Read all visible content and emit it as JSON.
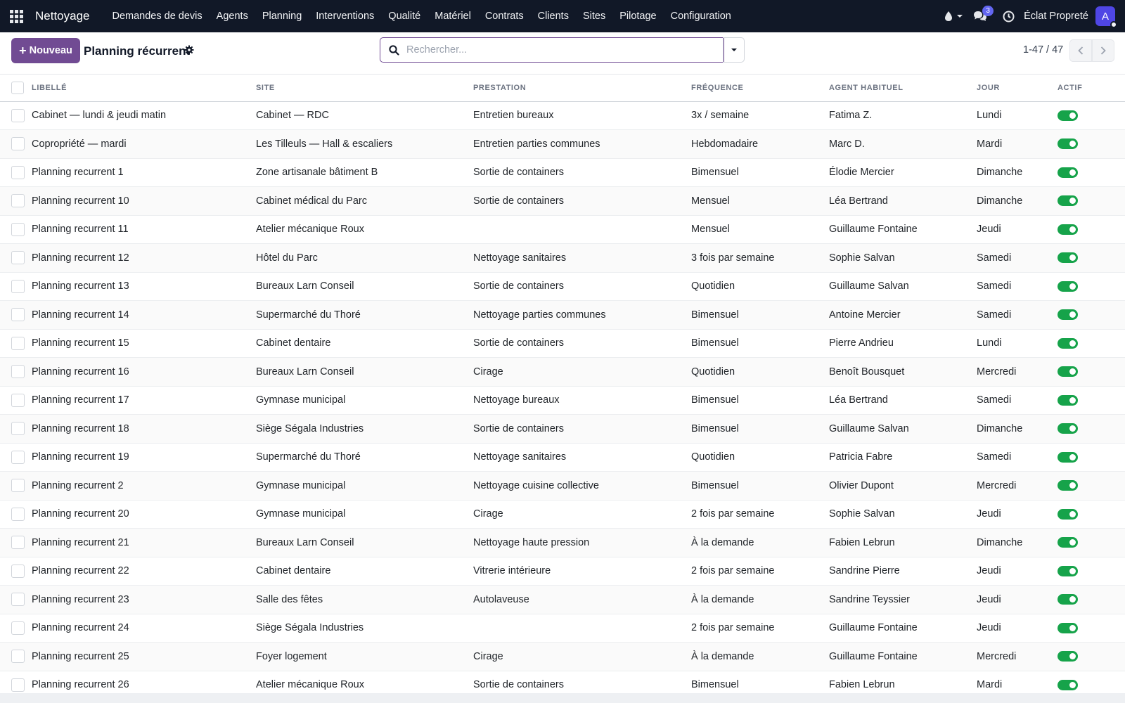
{
  "navbar": {
    "brand": "Nettoyage",
    "menu": [
      "Demandes de devis",
      "Agents",
      "Planning",
      "Interventions",
      "Qualité",
      "Matériel",
      "Contrats",
      "Clients",
      "Sites",
      "Pilotage",
      "Configuration"
    ],
    "messages_count": "3",
    "company": "Éclat Propreté",
    "avatar_letter": "A"
  },
  "control": {
    "new_label": "Nouveau",
    "title": "Planning récurrent",
    "search_placeholder": "Rechercher...",
    "pager": "1-47 / 47"
  },
  "table": {
    "columns": [
      "LIBELLÉ",
      "SITE",
      "PRESTATION",
      "FRÉQUENCE",
      "AGENT HABITUEL",
      "JOUR",
      "ACTIF"
    ],
    "rows": [
      {
        "libelle": "Cabinet — lundi & jeudi matin",
        "site": "Cabinet — RDC",
        "prestation": "Entretien bureaux",
        "frequence": "3x / semaine",
        "agent": "Fatima Z.",
        "jour": "Lundi",
        "actif": true
      },
      {
        "libelle": "Copropriété — mardi",
        "site": "Les Tilleuls — Hall & escaliers",
        "prestation": "Entretien parties communes",
        "frequence": "Hebdomadaire",
        "agent": "Marc D.",
        "jour": "Mardi",
        "actif": true
      },
      {
        "libelle": "Planning recurrent 1",
        "site": "Zone artisanale bâtiment B",
        "prestation": "Sortie de containers",
        "frequence": "Bimensuel",
        "agent": "Élodie Mercier",
        "jour": "Dimanche",
        "actif": true
      },
      {
        "libelle": "Planning recurrent 10",
        "site": "Cabinet médical du Parc",
        "prestation": "Sortie de containers",
        "frequence": "Mensuel",
        "agent": "Léa Bertrand",
        "jour": "Dimanche",
        "actif": true
      },
      {
        "libelle": "Planning recurrent 11",
        "site": "Atelier mécanique Roux",
        "prestation": "",
        "frequence": "Mensuel",
        "agent": "Guillaume Fontaine",
        "jour": "Jeudi",
        "actif": true
      },
      {
        "libelle": "Planning recurrent 12",
        "site": "Hôtel du Parc",
        "prestation": "Nettoyage sanitaires",
        "frequence": "3 fois par semaine",
        "agent": "Sophie Salvan",
        "jour": "Samedi",
        "actif": true
      },
      {
        "libelle": "Planning recurrent 13",
        "site": "Bureaux Larn Conseil",
        "prestation": "Sortie de containers",
        "frequence": "Quotidien",
        "agent": "Guillaume Salvan",
        "jour": "Samedi",
        "actif": true
      },
      {
        "libelle": "Planning recurrent 14",
        "site": "Supermarché du Thoré",
        "prestation": "Nettoyage parties communes",
        "frequence": "Bimensuel",
        "agent": "Antoine Mercier",
        "jour": "Samedi",
        "actif": true
      },
      {
        "libelle": "Planning recurrent 15",
        "site": "Cabinet dentaire",
        "prestation": "Sortie de containers",
        "frequence": "Bimensuel",
        "agent": "Pierre Andrieu",
        "jour": "Lundi",
        "actif": true
      },
      {
        "libelle": "Planning recurrent 16",
        "site": "Bureaux Larn Conseil",
        "prestation": "Cirage",
        "frequence": "Quotidien",
        "agent": "Benoît Bousquet",
        "jour": "Mercredi",
        "actif": true
      },
      {
        "libelle": "Planning recurrent 17",
        "site": "Gymnase municipal",
        "prestation": "Nettoyage bureaux",
        "frequence": "Bimensuel",
        "agent": "Léa Bertrand",
        "jour": "Samedi",
        "actif": true
      },
      {
        "libelle": "Planning recurrent 18",
        "site": "Siège Ségala Industries",
        "prestation": "Sortie de containers",
        "frequence": "Bimensuel",
        "agent": "Guillaume Salvan",
        "jour": "Dimanche",
        "actif": true
      },
      {
        "libelle": "Planning recurrent 19",
        "site": "Supermarché du Thoré",
        "prestation": "Nettoyage sanitaires",
        "frequence": "Quotidien",
        "agent": "Patricia Fabre",
        "jour": "Samedi",
        "actif": true
      },
      {
        "libelle": "Planning recurrent 2",
        "site": "Gymnase municipal",
        "prestation": "Nettoyage cuisine collective",
        "frequence": "Bimensuel",
        "agent": "Olivier Dupont",
        "jour": "Mercredi",
        "actif": true
      },
      {
        "libelle": "Planning recurrent 20",
        "site": "Gymnase municipal",
        "prestation": "Cirage",
        "frequence": "2 fois par semaine",
        "agent": "Sophie Salvan",
        "jour": "Jeudi",
        "actif": true
      },
      {
        "libelle": "Planning recurrent 21",
        "site": "Bureaux Larn Conseil",
        "prestation": "Nettoyage haute pression",
        "frequence": "À la demande",
        "agent": "Fabien Lebrun",
        "jour": "Dimanche",
        "actif": true
      },
      {
        "libelle": "Planning recurrent 22",
        "site": "Cabinet dentaire",
        "prestation": "Vitrerie intérieure",
        "frequence": "2 fois par semaine",
        "agent": "Sandrine Pierre",
        "jour": "Jeudi",
        "actif": true
      },
      {
        "libelle": "Planning recurrent 23",
        "site": "Salle des fêtes",
        "prestation": "Autolaveuse",
        "frequence": "À la demande",
        "agent": "Sandrine Teyssier",
        "jour": "Jeudi",
        "actif": true
      },
      {
        "libelle": "Planning recurrent 24",
        "site": "Siège Ségala Industries",
        "prestation": "",
        "frequence": "2 fois par semaine",
        "agent": "Guillaume Fontaine",
        "jour": "Jeudi",
        "actif": true
      },
      {
        "libelle": "Planning recurrent 25",
        "site": "Foyer logement",
        "prestation": "Cirage",
        "frequence": "À la demande",
        "agent": "Guillaume Fontaine",
        "jour": "Mercredi",
        "actif": true
      },
      {
        "libelle": "Planning recurrent 26",
        "site": "Atelier mécanique Roux",
        "prestation": "Sortie de containers",
        "frequence": "Bimensuel",
        "agent": "Fabien Lebrun",
        "jour": "Mardi",
        "actif": true
      }
    ]
  },
  "colors": {
    "navbar_bg": "#111827",
    "primary": "#714b93",
    "toggle_on": "#16a34a",
    "badge": "#6366f1"
  }
}
